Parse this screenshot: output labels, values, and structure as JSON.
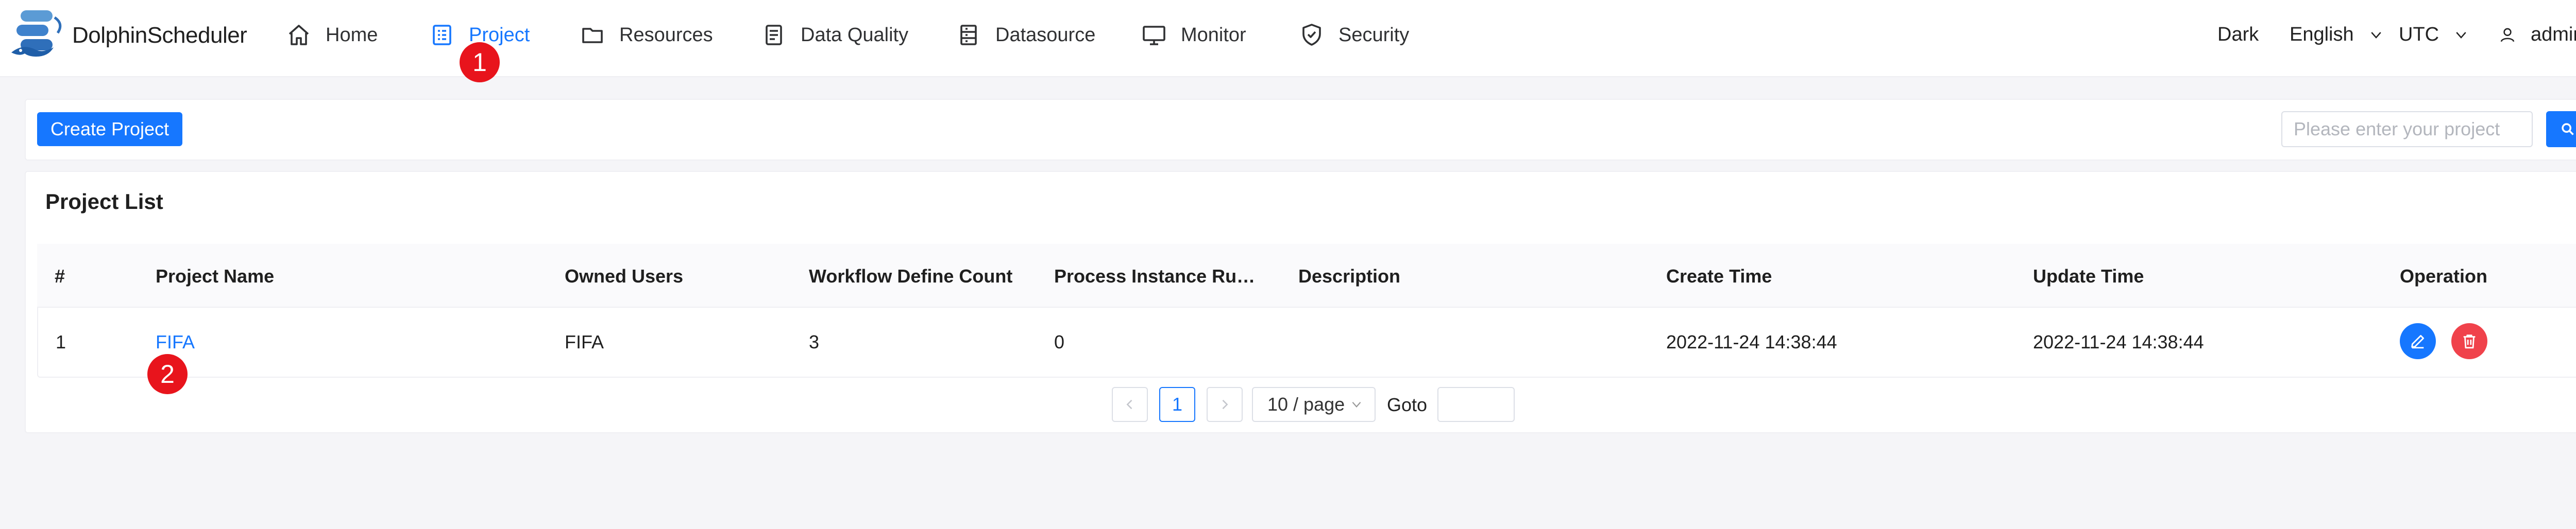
{
  "header": {
    "brand": "DolphinScheduler",
    "nav": [
      {
        "label": "Home",
        "icon": "home-icon"
      },
      {
        "label": "Project",
        "icon": "project-icon",
        "active": true
      },
      {
        "label": "Resources",
        "icon": "folder-icon"
      },
      {
        "label": "Data Quality",
        "icon": "data-quality-icon"
      },
      {
        "label": "Datasource",
        "icon": "datasource-icon"
      },
      {
        "label": "Monitor",
        "icon": "monitor-icon"
      },
      {
        "label": "Security",
        "icon": "shield-icon"
      }
    ],
    "theme": "Dark",
    "language": "English",
    "timezone": "UTC",
    "user": "admin"
  },
  "toolbar": {
    "create_label": "Create Project",
    "search_placeholder": "Please enter your project",
    "search_value": ""
  },
  "project_list": {
    "title": "Project List",
    "columns": [
      "#",
      "Project Name",
      "Owned Users",
      "Workflow Define Count",
      "Process Instance Running Count",
      "Description",
      "Create Time",
      "Update Time",
      "Operation"
    ],
    "rows": [
      {
        "index": "1",
        "name": "FIFA",
        "owner": "FIFA",
        "workflow_count": "3",
        "running_count": "0",
        "description": "",
        "create_time": "2022-11-24 14:38:44",
        "update_time": "2022-11-24 14:38:44"
      }
    ]
  },
  "pagination": {
    "current_page": "1",
    "page_size": "10 / page",
    "goto_label": "Goto",
    "goto_value": ""
  },
  "annotations": {
    "marker_1": "1",
    "marker_2": "2"
  },
  "colors": {
    "accent": "#1677ff",
    "danger": "#f0424b",
    "marker": "#e8141c"
  }
}
